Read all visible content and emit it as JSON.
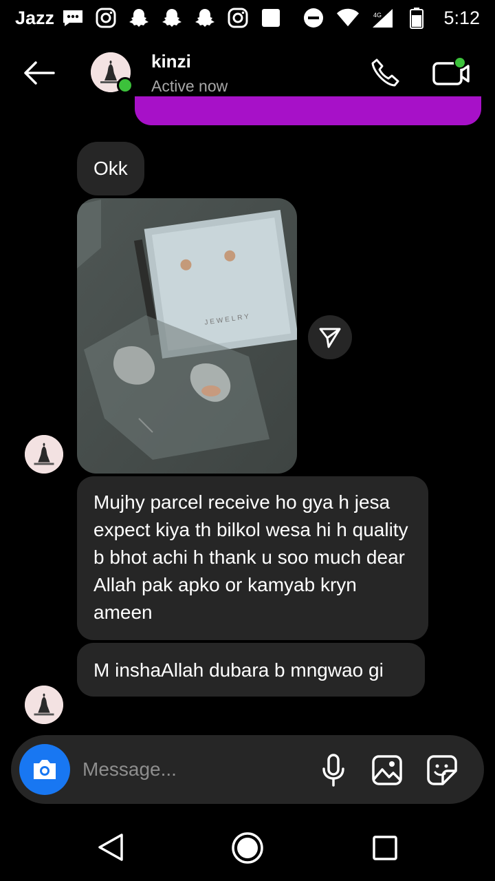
{
  "status_bar": {
    "carrier": "Jazz",
    "time": "5:12",
    "notification_icons": [
      "messages-icon",
      "instagram-icon",
      "snapchat-icon",
      "snapchat-icon",
      "snapchat-icon",
      "instagram-icon",
      "square-notification-icon"
    ],
    "system_icons": [
      "do-not-disturb-icon",
      "wifi-icon",
      "signal-icon",
      "battery-icon"
    ]
  },
  "header": {
    "contact_name": "kinzi",
    "contact_status": "Active now",
    "online_color": "#3cc13b"
  },
  "messages": {
    "received_short": "Okk",
    "received_long": "Mujhy parcel receive ho gya h jesa expect kiya th bilkol wesa hi h quality b bhot achi h thank u soo much dear Allah pak apko or kamyab kryn ameen",
    "received_last": "M inshaAllah dubara b mngwao gi",
    "sent_bubble_color": "#a711c8",
    "received_bubble_color": "#262626"
  },
  "composer": {
    "placeholder": "Message...",
    "camera_color": "#1877f2"
  }
}
